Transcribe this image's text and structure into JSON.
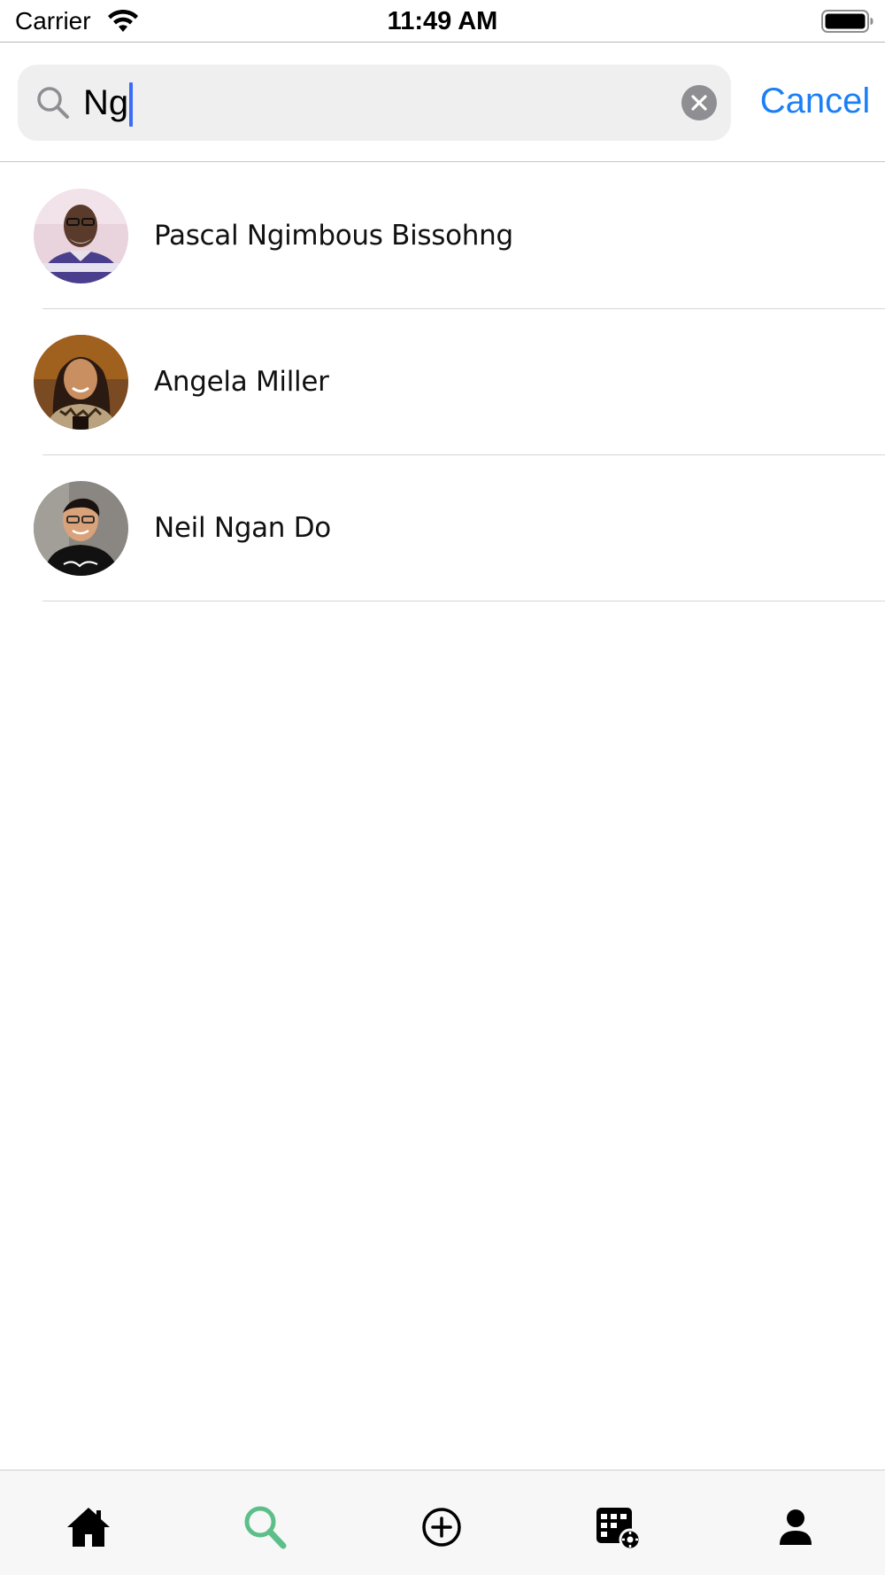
{
  "status_bar": {
    "carrier": "Carrier",
    "time": "11:49 AM"
  },
  "search": {
    "value": "Ng",
    "cancel_label": "Cancel"
  },
  "results": [
    {
      "name": "Pascal Ngimbous Bissohng",
      "avatar": "avatar-photo-man-glasses"
    },
    {
      "name": "Angela Miller",
      "avatar": "avatar-photo-woman"
    },
    {
      "name": "Neil Ngan Do",
      "avatar": "avatar-photo-man-love-shirt"
    }
  ],
  "tab_bar": {
    "items": [
      {
        "icon": "home-icon",
        "active": false
      },
      {
        "icon": "search-icon",
        "active": true
      },
      {
        "icon": "add-circle-icon",
        "active": false
      },
      {
        "icon": "calendar-icon",
        "active": false
      },
      {
        "icon": "profile-icon",
        "active": false
      }
    ]
  },
  "colors": {
    "accent_blue": "#1b7ff5",
    "active_tab_green": "#5cbf8a",
    "caret_blue": "#3b6cf5"
  }
}
